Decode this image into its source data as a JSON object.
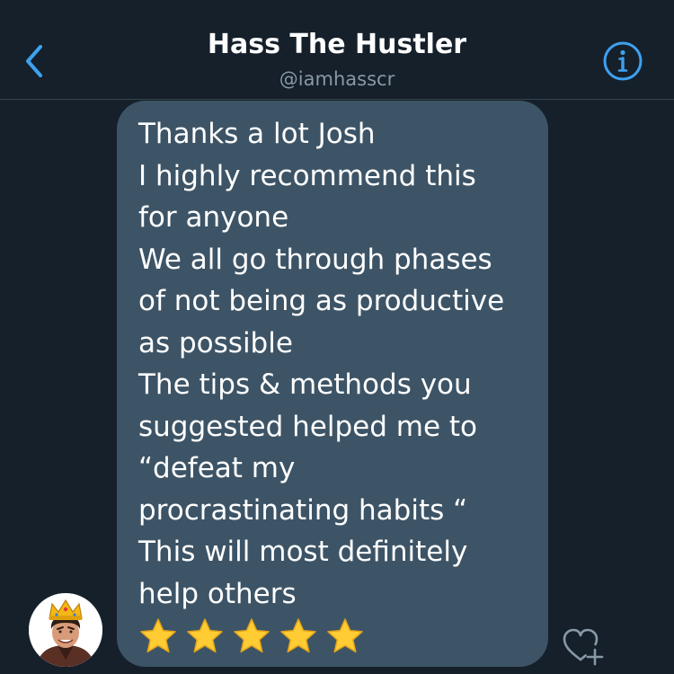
{
  "header": {
    "title": "Hass The Hustler",
    "handle": "@iamhasscr",
    "back_icon": "chevron-left-icon",
    "info_icon": "info-circle-icon"
  },
  "message": {
    "lines": [
      "Thanks a lot Josh",
      "I highly recommend this",
      "for anyone",
      "We all go through phases",
      "of not being as productive",
      "as possible",
      "The tips & methods you",
      "suggested helped me to",
      "“defeat my",
      "procrastinating habits “",
      "This will most definitely",
      "help others"
    ],
    "stars": 5,
    "star_icon": "star-emoji-icon"
  },
  "sender": {
    "avatar_icon": "avatar-crowned-man"
  },
  "actions": {
    "like_icon": "heart-plus-icon"
  },
  "colors": {
    "background": "#15202b",
    "bubble": "#3d5466",
    "accent": "#1d9bf0",
    "muted": "#8899a6",
    "divider": "#38444d",
    "star": "#ffcc33"
  }
}
